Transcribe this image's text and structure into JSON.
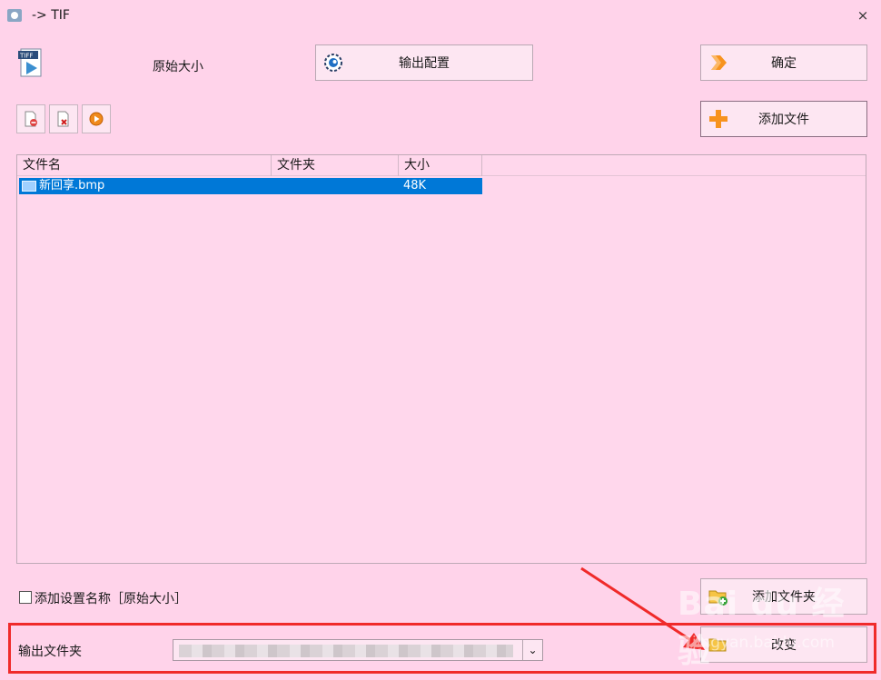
{
  "window": {
    "title": "-> TIF",
    "close_glyph": "×"
  },
  "format": {
    "icon": "tiff-file-icon",
    "icon_text": "TIFF",
    "label": "原始大小"
  },
  "buttons": {
    "output_config": "输出配置",
    "ok": "确定",
    "add_file": "添加文件",
    "add_folder": "添加文件夹",
    "change": "改变"
  },
  "toolbar": [
    "remove-file-icon",
    "clear-list-icon",
    "play-icon"
  ],
  "list": {
    "columns": [
      "文件名",
      "文件夹",
      "大小"
    ],
    "rows": [
      {
        "name": "新回享.bmp",
        "folder": "",
        "size": "48K",
        "selected": true
      }
    ]
  },
  "options": {
    "add_setting_name": {
      "label": "添加设置名称［原始大小］",
      "checked": false
    }
  },
  "output": {
    "label": "输出文件夹",
    "folder_value": "",
    "dropdown_glyph": "⌄"
  },
  "watermark": {
    "brand": "Bai du 经验",
    "url": "jingyan.baidu.com"
  },
  "colors": {
    "background": "#ffd3ea",
    "selection": "#0078d7",
    "annotation": "#f02a2a",
    "accent_orange": "#f7931e"
  }
}
